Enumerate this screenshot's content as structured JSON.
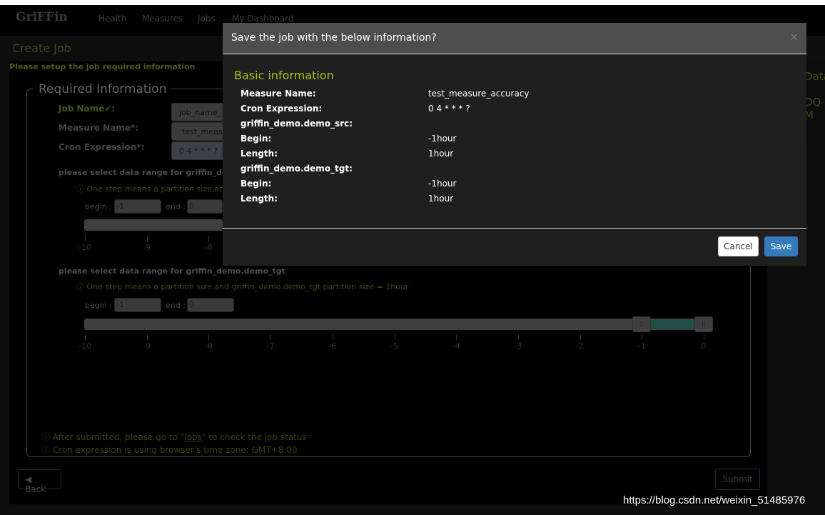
{
  "nav": {
    "brand": "GriFFin",
    "links": [
      "Health",
      "Measures",
      "Jobs",
      "My Dashboard"
    ]
  },
  "page": {
    "title": "Create Job",
    "subtitle": "Please setup the job required information",
    "right_texts": [
      "Data",
      "DQ M"
    ]
  },
  "form": {
    "legend": "Required Information",
    "job_name_label": "Job Name✔:",
    "job_name_value": "job_name_",
    "measure_name_label": "Measure Name*:",
    "measure_name_value": "test_meas",
    "cron_label": "Cron Expression*:",
    "cron_value": "0 4 * * * ?",
    "src_section": "please select data range for griffin_dem",
    "src_hint": "One step means a partition size,an",
    "tgt_section": "please select data range for griffin_demo.demo_tgt",
    "tgt_hint": "One step means a partition size,and griffin_demo.demo_tgt partition size = 1hour",
    "begin_label": "begin :",
    "end_label": "end :",
    "src_begin": "-1",
    "src_end": "0",
    "tgt_begin": "-1",
    "tgt_end": "0",
    "ticks": [
      "-10",
      "-9",
      "-8",
      "-7",
      "-6",
      "-5",
      "-4",
      "-3",
      "-2",
      "-1",
      "0"
    ],
    "tgt_range": {
      "min": -10,
      "max": 0,
      "begin": -1,
      "end": 0
    },
    "footer_note1_pre": "After submitted, please go to \"",
    "footer_note1_link": "Jobs",
    "footer_note1_post": "\" to check the job status",
    "footer_note2": "Cron expression is using browser's time zone: GMT+8:00",
    "back_label": "Back",
    "submit_label": "Submit"
  },
  "modal": {
    "title": "Save the job with the below information?",
    "close": "×",
    "section": "Basic information",
    "rows": [
      {
        "k": "Measure Name:",
        "v": "test_measure_accuracy"
      },
      {
        "k": "Cron Expression:",
        "v": "0 4 * * * ?"
      },
      {
        "k": "griffin_demo.demo_src:",
        "v": ""
      },
      {
        "k": "Begin:",
        "v": "-1hour"
      },
      {
        "k": "Length:",
        "v": "1hour"
      },
      {
        "k": "griffin_demo.demo_tgt:",
        "v": ""
      },
      {
        "k": "Begin:",
        "v": "-1hour"
      },
      {
        "k": "Length:",
        "v": "1hour"
      }
    ],
    "cancel": "Cancel",
    "save": "Save"
  },
  "colors": {
    "accent": "#a6c11e",
    "primary": "#337ab7",
    "range": "#1f4f47"
  },
  "watermark": "https://blog.csdn.net/weixin_51485976"
}
